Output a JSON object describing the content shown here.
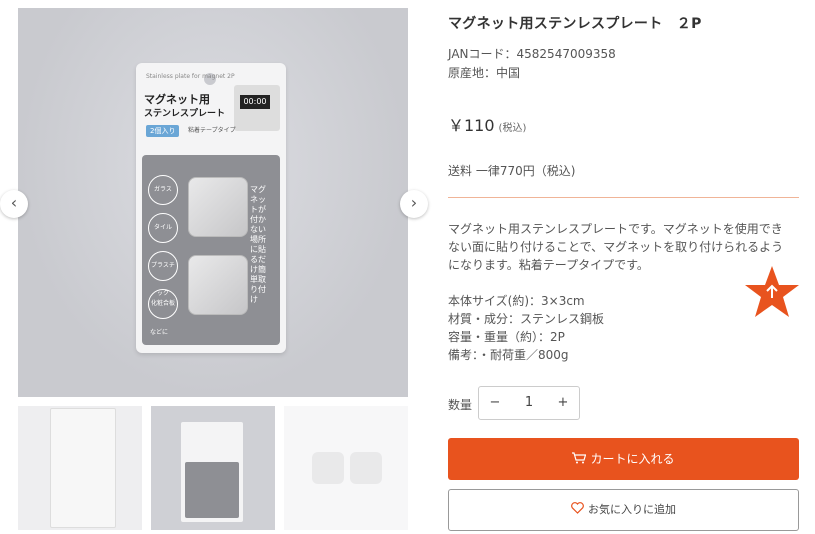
{
  "product": {
    "title": "マグネット用ステンレスプレート　２P",
    "jan": "JANコード：4582547009358",
    "origin": "原産地：中国",
    "price": "￥110",
    "price_tax": "(税込)",
    "shipping": "送料 一律770円（税込)",
    "description": "マグネット用ステンレスプレートです。マグネットを使用できない面に貼り付けることで、マグネットを取り付けられるようになります。粘着テープタイプです。",
    "specs": [
      "本体サイズ(約)：3×3cm",
      "材質・成分：ステンレス鋼板",
      "容量・重量（約）：2P",
      "備考：・耐荷重／800g"
    ]
  },
  "quantity": {
    "label": "数量",
    "value": "1",
    "minus": "−",
    "plus": "+"
  },
  "buttons": {
    "cart": "カートに入れる",
    "favorite": "お気に入りに追加"
  },
  "gallery": {
    "prev": "‹",
    "next": "›",
    "package": {
      "english": "Stainless plate\nfor magnet 2P",
      "title_line1": "マグネット用",
      "title_line2": "ステンレスプレート",
      "badge": "2個入り",
      "tape": "粘着テープタイプ",
      "circles": [
        "ガラス",
        "タイル",
        "プラスチック",
        "化粧合板"
      ],
      "etc": "などに",
      "vertical": "マグネットが付かない場所に貼るだけ簡単取り付け",
      "timer": "00:00"
    }
  },
  "colors": {
    "accent": "#e8531e",
    "divider": "#f0b497"
  },
  "icons": {
    "cart": "cart-icon",
    "heart": "heart-icon",
    "star": "star-icon"
  }
}
